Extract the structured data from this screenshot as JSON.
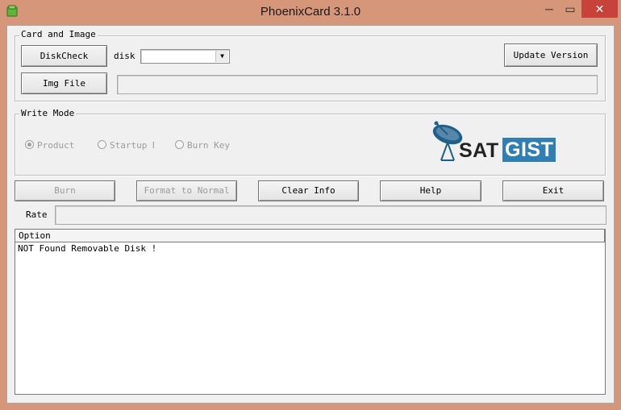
{
  "window": {
    "title": "PhoenixCard 3.1.0",
    "controls": {
      "minimize": "─",
      "maximize": "▭",
      "close": "✕"
    }
  },
  "card_and_image": {
    "legend": "Card and Image",
    "diskcheck_label": "DiskCheck",
    "disk_label": "disk",
    "disk_value": "",
    "update_label": "Update Version",
    "imgfile_label": "Img File",
    "img_path_value": ""
  },
  "write_mode": {
    "legend": "Write Mode",
    "options": [
      {
        "label": "Product",
        "checked": true
      },
      {
        "label": "Startup N",
        "checked": false
      },
      {
        "label": "Burn Key",
        "checked": false
      }
    ]
  },
  "logo": {
    "text_left": "SAT",
    "text_right": "GIST",
    "accent_color": "#2f7fb5"
  },
  "actions": {
    "burn": "Burn",
    "format": "Format to Normal",
    "clear": "Clear Info",
    "help": "Help",
    "exit": "Exit"
  },
  "rate": {
    "label": "Rate"
  },
  "log": {
    "header": "Option",
    "lines": [
      "NOT Found Removable Disk !"
    ]
  }
}
